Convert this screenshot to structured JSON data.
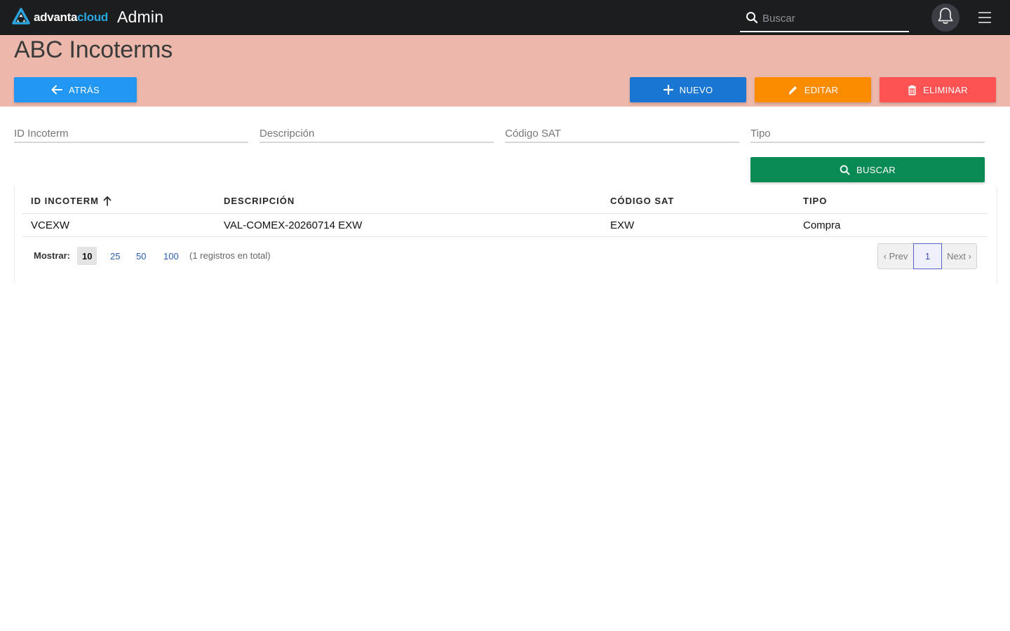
{
  "app": {
    "brand_prefix": "advanta",
    "brand_suffix": "cloud",
    "title": "Admin"
  },
  "topbar": {
    "search_placeholder": "Buscar",
    "icons": [
      "search-icon",
      "bell-icon",
      "hamburger-menu-icon"
    ]
  },
  "page": {
    "title": "ABC Incoterms"
  },
  "actions": {
    "back_label": "ATRÁS",
    "new_label": "NUEVO",
    "edit_label": "EDITAR",
    "delete_label": "ELIMINAR",
    "search_label": "BUSCAR"
  },
  "filters": {
    "id_placeholder": "ID Incoterm",
    "description_placeholder": "Descripción",
    "sat_code_placeholder": "Código SAT",
    "type_placeholder": "Tipo"
  },
  "table": {
    "columns": [
      "ID INCOTERM",
      "DESCRIPCIÓN",
      "CÓDIGO SAT",
      "TIPO"
    ],
    "sorted_column": "ID INCOTERM",
    "sort_direction": "ascending",
    "rows": [
      [
        "VCEXW",
        "VAL-COMEX-20260714 EXW",
        "EXW",
        "Compra"
      ]
    ]
  },
  "pagination": {
    "show_label": "Mostrar:",
    "page_sizes": [
      "10",
      "25",
      "50",
      "100"
    ],
    "selected_page_size": "10",
    "total_text": "(1 registros en total)",
    "prev_label": "‹ Prev",
    "current_page": "1",
    "next_label": "Next ›"
  },
  "colors": {
    "topbar": "#1c1d1f",
    "header_band": "#ecb8ab",
    "back_button": "#2196f3",
    "new_button": "#1976d2",
    "edit_button": "#fb8c00",
    "delete_button": "#ff5252",
    "search_button": "#078a54",
    "brand_accent": "#2aa5e0"
  }
}
